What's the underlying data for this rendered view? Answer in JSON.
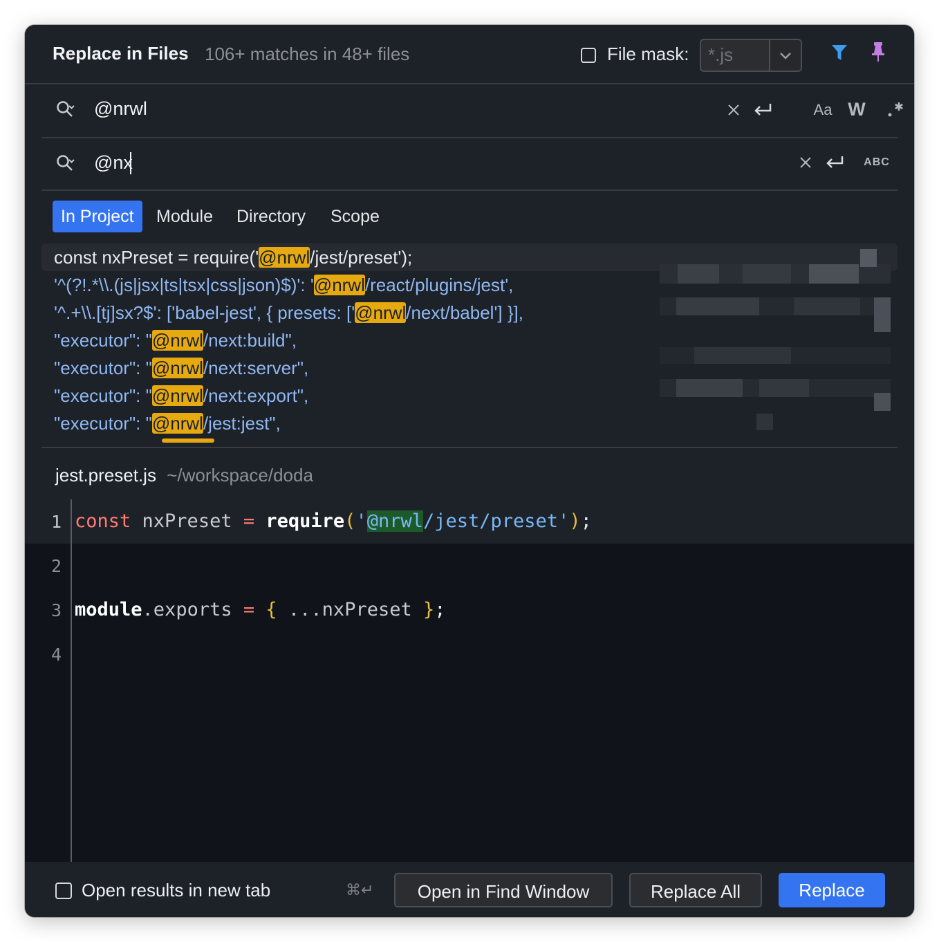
{
  "header": {
    "title": "Replace in Files",
    "matches": "106+ matches in 48+ files",
    "file_mask_label": "File mask:",
    "file_mask_value": "*.js",
    "filter_icon": "funnel-icon",
    "pin_icon": "pin-icon"
  },
  "search": {
    "query": "@nrwl",
    "options": [
      "Aa",
      "W",
      ".*"
    ]
  },
  "replace": {
    "query": "@nx",
    "preserve_case": "ABC"
  },
  "scopes": [
    "In Project",
    "Module",
    "Directory",
    "Scope"
  ],
  "results": [
    {
      "before": "const nxPreset = require('",
      "match": "@nrwl",
      "after": "/jest/preset');"
    },
    {
      "before": "'^(?!.*\\\\.(js|jsx|ts|tsx|css|json)$)': '",
      "match": "@nrwl",
      "after": "/react/plugins/jest',"
    },
    {
      "before": "'^.+\\\\.[tj]sx?$': ['babel-jest', { presets: ['",
      "match": "@nrwl",
      "after": "/next/babel'] }],"
    },
    {
      "before": "\"executor\": \"",
      "match": "@nrwl",
      "after": "/next:build\","
    },
    {
      "before": "\"executor\": \"",
      "match": "@nrwl",
      "after": "/next:server\","
    },
    {
      "before": "\"executor\": \"",
      "match": "@nrwl",
      "after": "/next:export\","
    },
    {
      "before": "\"executor\": \"",
      "match": "@nrwl",
      "after": "/jest:jest\","
    }
  ],
  "preview": {
    "file_name": "jest.preset.js",
    "file_path": "~/workspace/doda",
    "line_numbers": [
      "1",
      "2",
      "3",
      "4"
    ],
    "line1": {
      "kw": "const",
      "name": " nxPreset ",
      "eq": "=",
      "fn": "require",
      "open": "(",
      "q1": "'",
      "match": "@nrwl",
      "rest": "/jest/preset'",
      "close": ")",
      "semi": ";"
    },
    "line3": {
      "obj": "module",
      "prop": ".exports ",
      "eq": "=",
      "ob": "{",
      "spread": " ...nxPreset ",
      "cb": "}",
      "semi": ";"
    }
  },
  "footer": {
    "open_new_tab": "Open results in new tab",
    "shortcut": "⌘↵",
    "open_find_window": "Open in Find Window",
    "replace_all": "Replace All",
    "replace": "Replace"
  },
  "colors": {
    "accent": "#3574f0",
    "match_highlight": "#e6a90f",
    "dialog_bg": "#1d2128"
  }
}
